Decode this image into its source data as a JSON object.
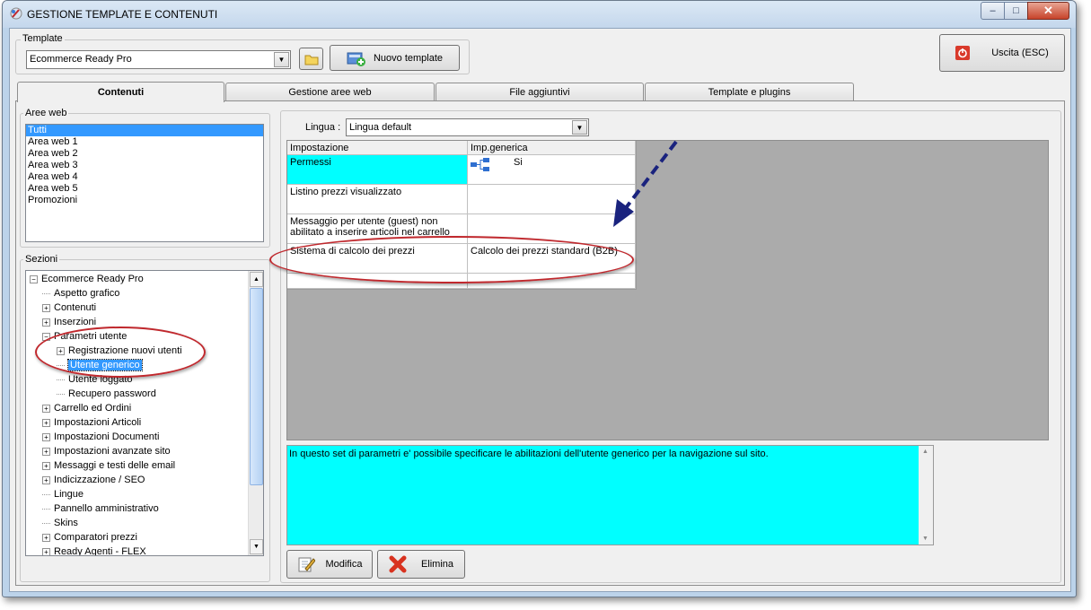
{
  "window": {
    "title": "GESTIONE TEMPLATE E CONTENUTI",
    "minimize": "–",
    "maximize": "□",
    "close": "✕"
  },
  "template": {
    "group_label": "Template",
    "selected": "Ecommerce Ready Pro",
    "new_button": "Nuovo template"
  },
  "exit_button": "Uscita (ESC)",
  "tabs": [
    {
      "label": "Contenuti"
    },
    {
      "label": "Gestione aree web"
    },
    {
      "label": "File aggiuntivi"
    },
    {
      "label": "Template e plugins"
    }
  ],
  "aree_web": {
    "label": "Aree web",
    "items": [
      "Tutti",
      "Area web 1",
      "Area web 2",
      "Area web 3",
      "Area web 4",
      "Area web 5",
      "Promozioni"
    ],
    "selected": "Tutti"
  },
  "sezioni": {
    "label": "Sezioni",
    "tree": [
      {
        "label": "Ecommerce Ready Pro",
        "level": 0,
        "toggle": "−"
      },
      {
        "label": "Aspetto grafico",
        "level": 1,
        "toggle": ""
      },
      {
        "label": "Contenuti",
        "level": 1,
        "toggle": "+"
      },
      {
        "label": "Inserzioni",
        "level": 1,
        "toggle": "+"
      },
      {
        "label": "Parametri utente",
        "level": 1,
        "toggle": "−"
      },
      {
        "label": "Registrazione nuovi utenti",
        "level": 2,
        "toggle": "+"
      },
      {
        "label": "Utente generico",
        "level": 2,
        "toggle": "",
        "selected": true
      },
      {
        "label": "Utente loggato",
        "level": 2,
        "toggle": ""
      },
      {
        "label": "Recupero password",
        "level": 2,
        "toggle": ""
      },
      {
        "label": "Carrello ed Ordini",
        "level": 1,
        "toggle": "+"
      },
      {
        "label": "Impostazioni Articoli",
        "level": 1,
        "toggle": "+"
      },
      {
        "label": "Impostazioni Documenti",
        "level": 1,
        "toggle": "+"
      },
      {
        "label": "Impostazioni avanzate sito",
        "level": 1,
        "toggle": "+"
      },
      {
        "label": "Messaggi e testi delle email",
        "level": 1,
        "toggle": "+"
      },
      {
        "label": "Indicizzazione / SEO",
        "level": 1,
        "toggle": "+"
      },
      {
        "label": "Lingue",
        "level": 1,
        "toggle": ""
      },
      {
        "label": "Pannello amministrativo",
        "level": 1,
        "toggle": ""
      },
      {
        "label": "Skins",
        "level": 1,
        "toggle": ""
      },
      {
        "label": "Comparatori prezzi",
        "level": 1,
        "toggle": "+"
      },
      {
        "label": "Ready Agenti - FLEX",
        "level": 1,
        "toggle": "+"
      }
    ]
  },
  "lingua": {
    "label": "Lingua :",
    "selected": "Lingua default"
  },
  "grid": {
    "headers": [
      "Impostazione",
      "Imp.generica"
    ],
    "rows": [
      {
        "setting": "Permessi",
        "value": "Si",
        "highlight": true
      },
      {
        "setting": "Listino prezzi visualizzato",
        "value": ""
      },
      {
        "setting": "Messaggio per utente (guest) non abilitato a inserire articoli nel carrello",
        "value": ""
      },
      {
        "setting": "Sistema di calcolo dei prezzi",
        "value": "Calcolo dei prezzi standard (B2B)"
      }
    ]
  },
  "description": "In questo set di parametri e' possibile specificare le abilitazioni dell'utente generico per la navigazione sul sito.",
  "buttons": {
    "modifica": "Modifica",
    "elimina": "Elimina"
  },
  "colors": {
    "selection": "#3399ff",
    "highlight": "#00ffff",
    "annotation": "#c0282d",
    "arrow": "#1a237e"
  }
}
